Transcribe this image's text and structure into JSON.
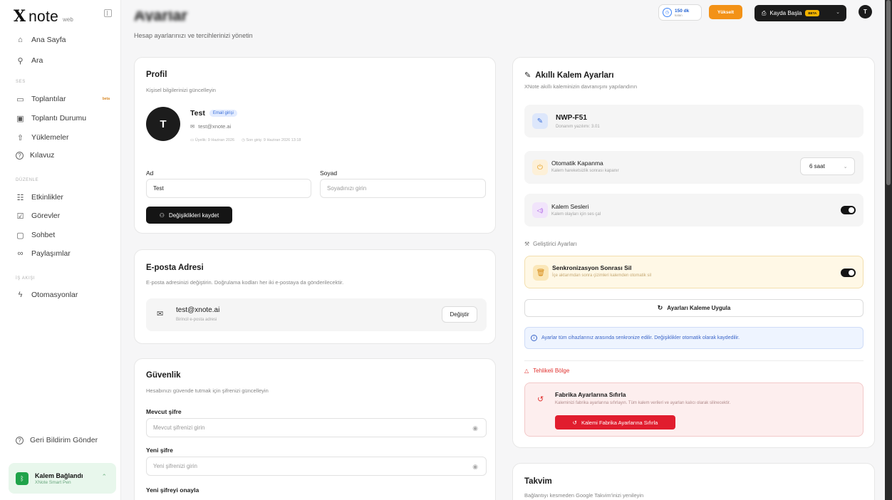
{
  "app": {
    "logo_x": "X",
    "logo_text": "note",
    "logo_sub": "web"
  },
  "sidebar": {
    "items_main": [
      {
        "label": "Ana Sayfa",
        "icon": "home-icon",
        "glyph": "⌂"
      },
      {
        "label": "Ara",
        "icon": "search-icon",
        "glyph": "⚲"
      }
    ],
    "section_ses": "SES",
    "items_ses": [
      {
        "label": "Toplantılar",
        "icon": "calendar-icon",
        "glyph": "▭",
        "badge": "beta"
      },
      {
        "label": "Toplantı Durumu",
        "icon": "clipboard-icon",
        "glyph": "▣"
      },
      {
        "label": "Yüklemeler",
        "icon": "upload-icon",
        "glyph": "⇧"
      },
      {
        "label": "Kılavuz",
        "icon": "help-icon",
        "glyph": "?"
      }
    ],
    "section_duzenle": "DÜZENLE",
    "items_duzenle": [
      {
        "label": "Etkinlikler",
        "icon": "list-icon",
        "glyph": "☷"
      },
      {
        "label": "Görevler",
        "icon": "checkbox-icon",
        "glyph": "☑"
      },
      {
        "label": "Sohbet",
        "icon": "chat-icon",
        "glyph": "▢"
      },
      {
        "label": "Paylaşımlar",
        "icon": "link-icon",
        "glyph": "∞"
      }
    ],
    "section_is_akisi": "İŞ AKIŞI",
    "items_is_akisi": [
      {
        "label": "Otomasyonlar",
        "icon": "lightning-icon",
        "glyph": "ϟ"
      }
    ],
    "feedback_label": "Geri Bildirim Gönder",
    "pen_card": {
      "title": "Kalem Bağlandı",
      "subtitle": "XNote Smart Pen"
    }
  },
  "topbar": {
    "credit_value": "150 dk",
    "credit_label": "kalan",
    "upgrade_label": "Yükselt",
    "record_label": "Kayda Başla",
    "record_badge": "BETA",
    "avatar_initial": "T"
  },
  "page": {
    "title": "Ayarlar",
    "subtitle": "Hesap ayarlarınızı ve tercihlerinizi yönetin"
  },
  "profile": {
    "heading": "Profil",
    "desc": "Kişisel bilgilerinizi güncelleyin",
    "avatar_initial": "T",
    "name": "Test",
    "login_badge": "Email girişi",
    "email": "test@xnote.ai",
    "member_since": "Üyelik: 9 Haziran 2026",
    "last_login": "Son giriş: 9 Haziran 2026 13:18",
    "first_name_label": "Ad",
    "first_name_value": "Test",
    "last_name_label": "Soyad",
    "last_name_placeholder": "Soyadınızı girin",
    "save_label": "Değişiklikleri kaydet"
  },
  "email_card": {
    "heading": "E-posta Adresi",
    "desc": "E-posta adresinizi değiştirin. Doğrulama kodları her iki e-postaya da gönderilecektir.",
    "email": "test@xnote.ai",
    "email_sub": "Birincil e-posta adresi",
    "change_label": "Değiştir"
  },
  "security": {
    "heading": "Güvenlik",
    "desc": "Hesabınızı güvende tutmak için şifrenizi güncelleyin",
    "current_label": "Mevcut şifre",
    "current_placeholder": "Mevcut şifrenizi girin",
    "new_label": "Yeni şifre",
    "new_placeholder": "Yeni şifrenizi girin",
    "confirm_label": "Yeni şifreyi onayla"
  },
  "pen_settings": {
    "heading": "Akıllı Kalem Ayarları",
    "desc": "XNote akıllı kaleminizin davranışını yapılandırın",
    "device_name": "NWP-F51",
    "device_sub": "Donanım yazılımı: 3.01",
    "auto_off_title": "Otomatik Kapanma",
    "auto_off_sub": "Kalem hareketsizlik sonrası kapanır",
    "auto_off_value": "6 saat",
    "sound_title": "Kalem Sesleri",
    "sound_sub": "Kalem olayları için ses çal",
    "dev_section": "Geliştirici Ayarları",
    "sync_delete_title": "Senkronizasyon Sonrası Sil",
    "sync_delete_sub": "İçe aktarımdan sonra çizimleri kalemden otomatik sil",
    "apply_label": "Ayarları Kaleme Uygula",
    "info_text": "Ayarlar tüm cihazlarınız arasında senkronize edilir. Değişiklikler otomatik olarak kaydedilir.",
    "danger_title": "Tehlikeli Bölge",
    "reset_title": "Fabrika Ayarlarına Sıfırla",
    "reset_sub": "Kaleminizi fabrika ayarlarına sıfırlayın. Tüm kalem verileri ve ayarları kalıcı olarak silinecektir.",
    "reset_button": "Kalemi Fabrika Ayarlarına Sıfırla"
  },
  "calendar": {
    "heading": "Takvim",
    "desc": "Bağlantıyı kesmeden Google Takvim'inizi yenileyin"
  },
  "colors": {
    "accent_orange": "#f39217",
    "danger_red": "#e11d2e",
    "success_green": "#20a34a",
    "info_blue": "#3b82f6"
  }
}
